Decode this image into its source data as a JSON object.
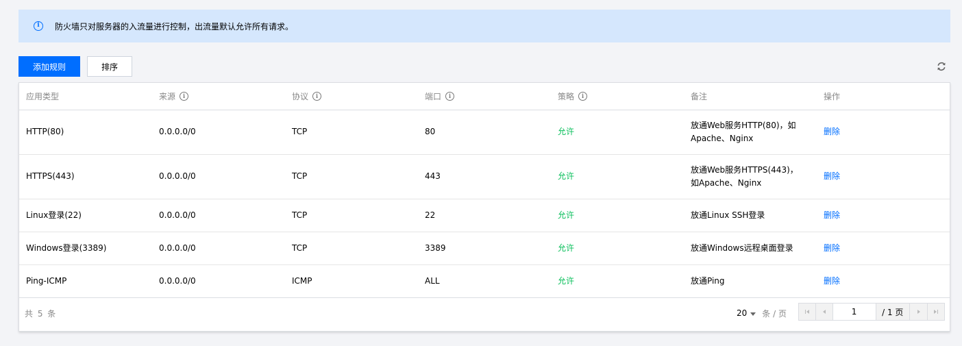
{
  "notice": {
    "icon": "info-icon",
    "text": "防火墙只对服务器的入流量进行控制，出流量默认允许所有请求。"
  },
  "toolbar": {
    "add_rule_label": "添加规则",
    "sort_label": "排序",
    "refresh_icon": "refresh-icon"
  },
  "table": {
    "columns": [
      {
        "label": "应用类型",
        "help": false
      },
      {
        "label": "来源",
        "help": true
      },
      {
        "label": "协议",
        "help": true
      },
      {
        "label": "端口",
        "help": true
      },
      {
        "label": "策略",
        "help": true
      },
      {
        "label": "备注",
        "help": false
      },
      {
        "label": "操作",
        "help": false
      }
    ],
    "rows": [
      {
        "app": "HTTP(80)",
        "source": "0.0.0.0/0",
        "protocol": "TCP",
        "port": "80",
        "policy": "允许",
        "note": "放通Web服务HTTP(80)，如Apache、Nginx",
        "action": "删除"
      },
      {
        "app": "HTTPS(443)",
        "source": "0.0.0.0/0",
        "protocol": "TCP",
        "port": "443",
        "policy": "允许",
        "note": "放通Web服务HTTPS(443)，如Apache、Nginx",
        "action": "删除"
      },
      {
        "app": "Linux登录(22)",
        "source": "0.0.0.0/0",
        "protocol": "TCP",
        "port": "22",
        "policy": "允许",
        "note": "放通Linux SSH登录",
        "action": "删除"
      },
      {
        "app": "Windows登录(3389)",
        "source": "0.0.0.0/0",
        "protocol": "TCP",
        "port": "3389",
        "policy": "允许",
        "note": "放通Windows远程桌面登录",
        "action": "删除"
      },
      {
        "app": "Ping-ICMP",
        "source": "0.0.0.0/0",
        "protocol": "ICMP",
        "port": "ALL",
        "policy": "允许",
        "note": "放通Ping",
        "action": "删除"
      }
    ]
  },
  "footer": {
    "total_text": "共 5 条",
    "page_size": "20",
    "page_size_unit": "条 / 页",
    "current_page": "1",
    "total_pages": "/ 1 页"
  },
  "colors": {
    "primary": "#006eff",
    "allow": "#0abf5b",
    "notice_bg": "#d5e7fd"
  }
}
